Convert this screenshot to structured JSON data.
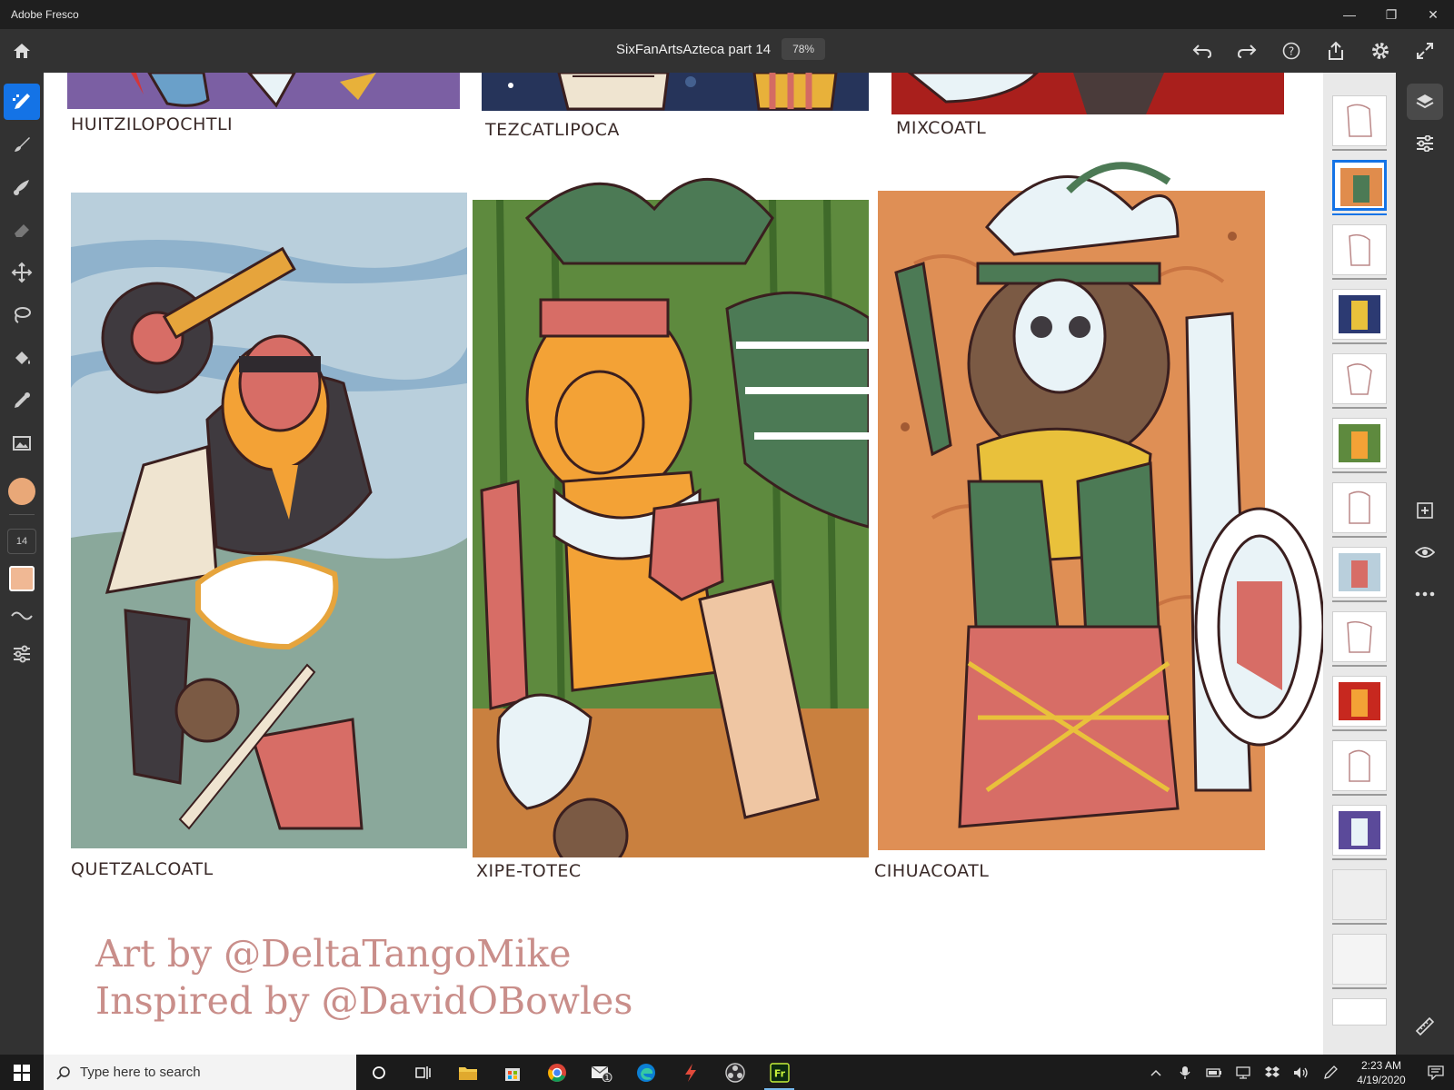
{
  "window": {
    "app_title": "Adobe Fresco",
    "minimize_glyph": "—",
    "restore_glyph": "❐",
    "close_glyph": "✕"
  },
  "document": {
    "title": "SixFanArtsAzteca part 14",
    "zoom": "78%"
  },
  "toolbar": {
    "brush_size": "14",
    "active_color": "#e9a878",
    "swatch_color": "#f0b894",
    "accent": "#1473e6"
  },
  "artwork": {
    "top_captions": [
      "HUITZILOPOCHTLI",
      "TEZCATLIPOCA",
      "MIXCOATL"
    ],
    "panels": [
      {
        "caption": "QUETZALCOATL",
        "bg": "#b9cfdc"
      },
      {
        "caption": "XIPE-TOTEC",
        "bg": "#5e8a3e"
      },
      {
        "caption": "CIHUACOATL",
        "bg": "#df8f55"
      }
    ],
    "credit_line_1": "Art by @DeltaTangoMike",
    "credit_line_2": "Inspired by @DavidOBowles"
  },
  "layers": {
    "count": 15,
    "active_index": 1
  },
  "taskbar": {
    "search_placeholder": "Type here to search",
    "time": "2:23 AM",
    "date": "4/19/2020",
    "mail_badge": "1"
  }
}
